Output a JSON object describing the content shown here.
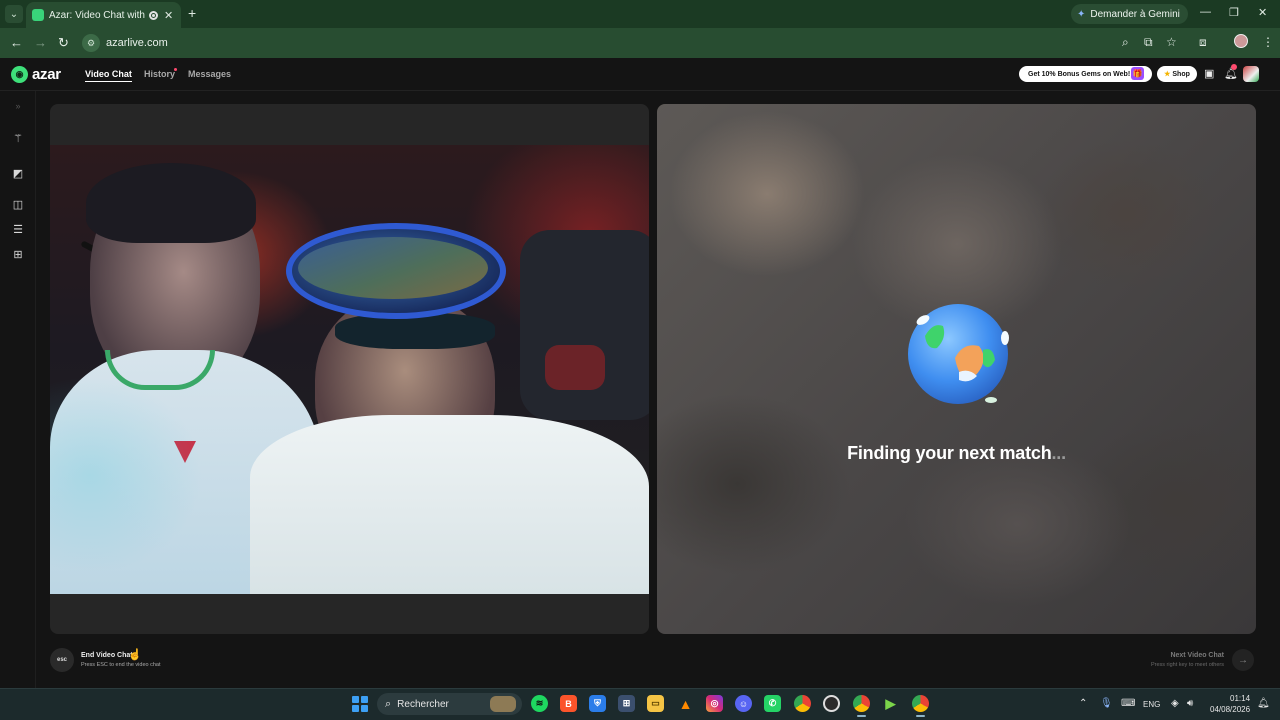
{
  "browser": {
    "tab_title": "Azar: Video Chat with New",
    "new_tab_symbol": "+",
    "close_symbol": "✕",
    "gemini_label": "Demander à Gemini",
    "url": "azarlive.com",
    "window_controls": [
      "—",
      "❐",
      "✕"
    ]
  },
  "app": {
    "logo_text": "azar",
    "nav": {
      "video_chat": "Video Chat",
      "history": "History",
      "messages": "Messages"
    },
    "promo_label": "Get 10% Bonus Gems on Web!",
    "shop_label": "Shop",
    "notification_count": "",
    "accent_color": "#3ee07a"
  },
  "rail": {
    "collapse_symbol": "»",
    "items": [
      "magic-wand",
      "filter",
      "layout-side-by-side",
      "layout-stacked",
      "layout-grid"
    ]
  },
  "stage": {
    "finding_text": "Finding your next match",
    "finding_dots": "..."
  },
  "controls": {
    "esc_label": "esc",
    "end_title": "End Video Chat",
    "end_sub": "Press ESC to end the video chat",
    "next_title": "Next Video Chat",
    "next_sub": "Press right key to meet others",
    "next_symbol": "→"
  },
  "taskbar": {
    "search_placeholder": "Rechercher",
    "language": "ENG",
    "time": "01:14",
    "date": "04/08/2026",
    "apps": [
      "spotify",
      "brave",
      "defender",
      "store",
      "file-explorer",
      "vlc",
      "instagram",
      "discord",
      "whatsapp",
      "chrome",
      "obs",
      "chrome-profile",
      "media-player",
      "chrome-active"
    ]
  }
}
